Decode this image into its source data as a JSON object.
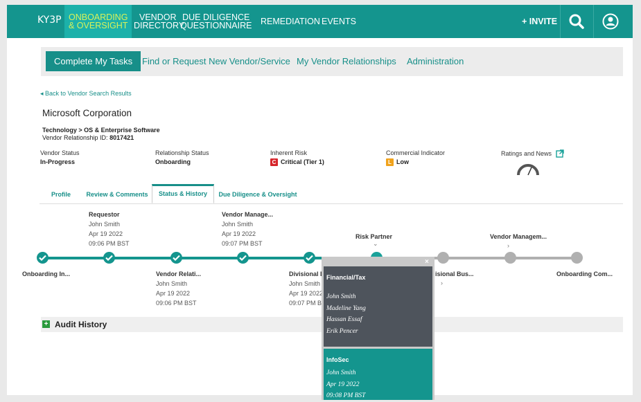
{
  "nav": {
    "logo": "KY3P",
    "items": [
      {
        "l1": "ONBOARDING",
        "l2": "& OVERSIGHT"
      },
      {
        "l1": "VENDOR",
        "l2": "DIRECTORY"
      },
      {
        "l1": "DUE DILIGENCE",
        "l2": "QUESTIONNAIRE"
      },
      {
        "l1": "REMEDIATION",
        "l2": ""
      },
      {
        "l1": "EVENTS",
        "l2": ""
      }
    ],
    "invite": "+ INVITE"
  },
  "subnav": {
    "active": "Complete My Tasks",
    "links": [
      "Find or Request New Vendor/Service",
      "My Vendor Relationships",
      "Administration"
    ]
  },
  "back_link": "◂ Back to Vendor Search Results",
  "company": "Microsoft Corporation",
  "industry": "Technology > OS & Enterprise Software",
  "relationship_id_label": "Vendor Relationship ID:",
  "relationship_id": "8017421",
  "info": {
    "vendor_status_label": "Vendor Status",
    "vendor_status": "In-Progress",
    "relationship_status_label": "Relationship Status",
    "relationship_status": "Onboarding",
    "inherent_risk_label": "Inherent Risk",
    "inherent_risk_badge": "C",
    "inherent_risk": "Critical (Tier 1)",
    "commercial_label": "Commercial Indicator",
    "commercial_badge": "L",
    "commercial": "Low",
    "ratings_label": "Ratings and News",
    "colors": {
      "critical": "#d6252b",
      "low": "#f0a21b"
    }
  },
  "tabs": [
    "Profile",
    "Review & Comments",
    "Status & History",
    "Due Diligence & Oversight"
  ],
  "timeline": {
    "top": [
      {
        "h": "Requestor",
        "name": "John Smith",
        "date": "Apr 19 2022",
        "time": "09:06 PM BST"
      },
      {
        "h": "Vendor Manage...",
        "name": "John Smith",
        "date": "Apr 19 2022",
        "time": "09:07 PM BST"
      },
      {
        "h": "Risk Partner",
        "chev": "⌄"
      },
      {
        "h": "Vendor Managem...",
        "chev": "›"
      }
    ],
    "bottom": [
      {
        "h": "Onboarding In..."
      },
      {
        "h": "Vendor Relati...",
        "name": "John Smith",
        "date": "Apr 19 2022",
        "time": "09:06 PM BST"
      },
      {
        "h": "Divisional E",
        "name": "John Smith",
        "date": "Apr 19 2022",
        "time": "09:07 PM B"
      },
      {
        "h": "isional Bus...",
        "chev": "›"
      },
      {
        "h": "Onboarding Com..."
      }
    ]
  },
  "audit_title": "Audit History",
  "popup": {
    "close": "×",
    "card1_title": "Financial/Tax",
    "card1_people": [
      "John Smith",
      "Madeline Yang",
      "Hassan Essaf",
      "Erik Pencer"
    ],
    "card2_title": "InfoSec",
    "card2_lines": [
      "John Smith",
      "Apr 19 2022",
      "09:08 PM BST"
    ]
  }
}
